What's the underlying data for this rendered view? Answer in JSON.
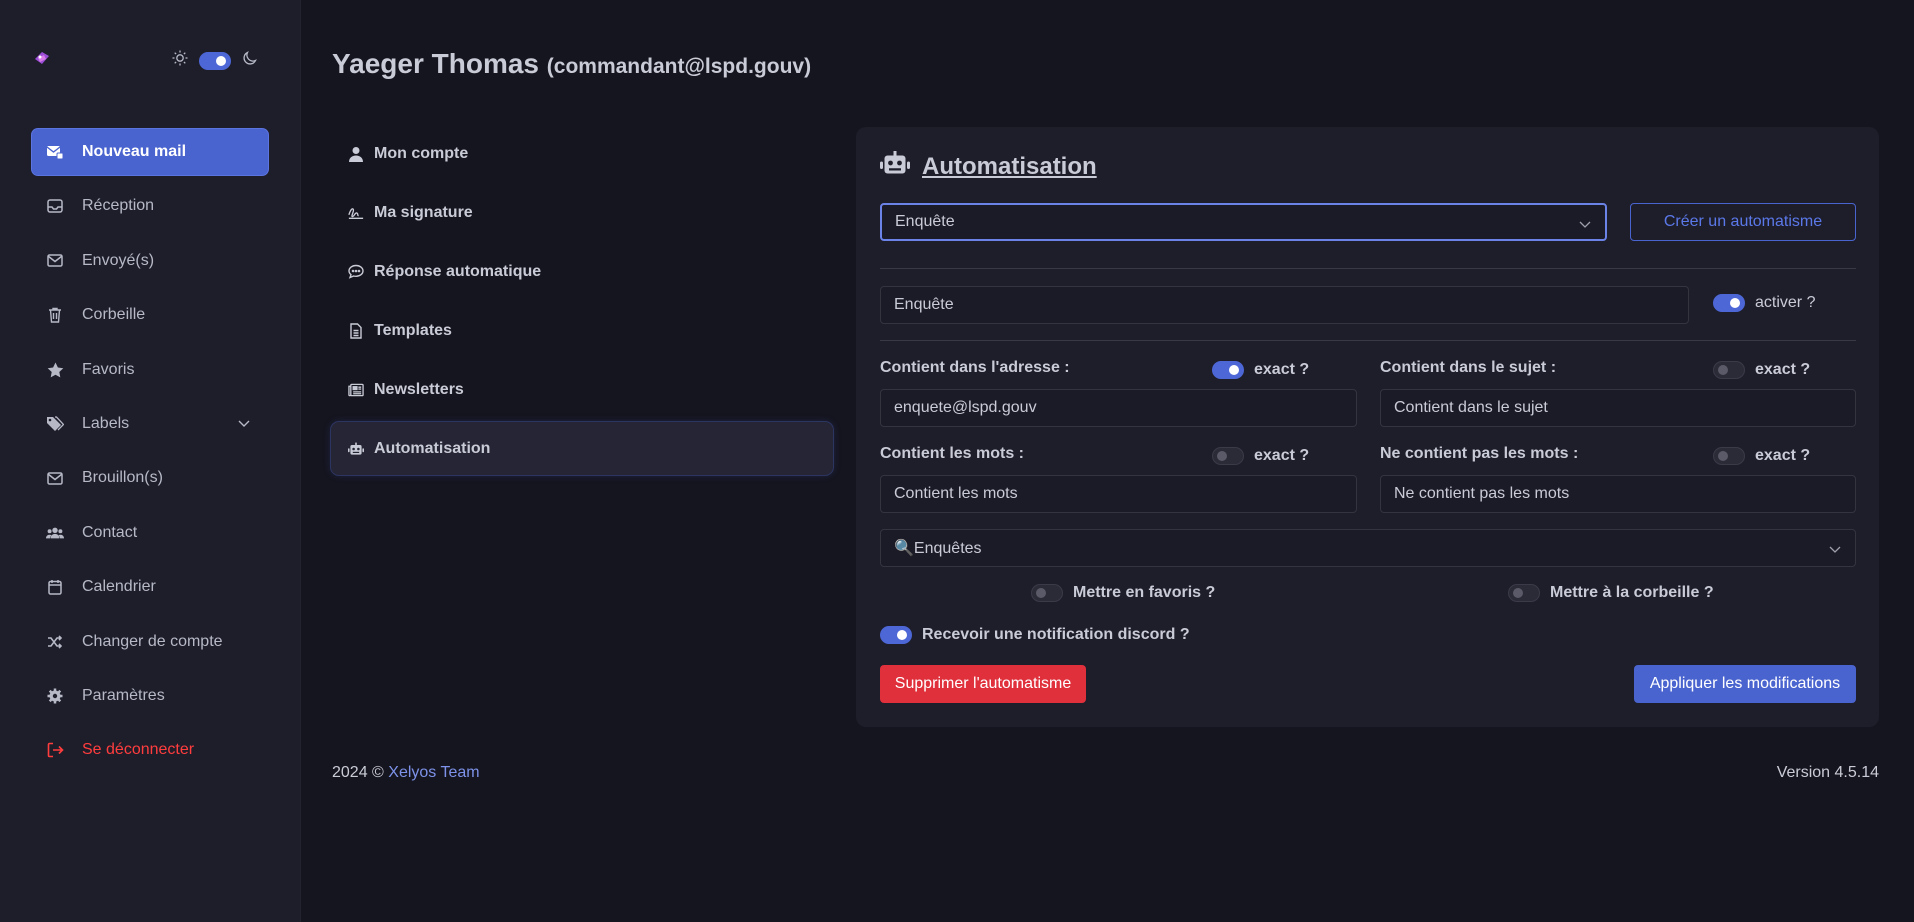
{
  "user": {
    "name": "Yaeger Thomas",
    "email": "(commandant@lspd.gouv)"
  },
  "sidebar": {
    "items": [
      {
        "label": "Nouveau mail",
        "icon": "new-mail-icon"
      },
      {
        "label": "Réception",
        "icon": "inbox-icon"
      },
      {
        "label": "Envoyé(s)",
        "icon": "sent-icon"
      },
      {
        "label": "Corbeille",
        "icon": "trash-icon"
      },
      {
        "label": "Favoris",
        "icon": "star-icon"
      },
      {
        "label": "Labels",
        "icon": "tags-icon"
      },
      {
        "label": "Brouillon(s)",
        "icon": "draft-icon"
      },
      {
        "label": "Contact",
        "icon": "users-icon"
      },
      {
        "label": "Calendrier",
        "icon": "calendar-icon"
      },
      {
        "label": "Changer de compte",
        "icon": "shuffle-icon"
      },
      {
        "label": "Paramètres",
        "icon": "gear-icon"
      },
      {
        "label": "Se déconnecter",
        "icon": "logout-icon"
      }
    ]
  },
  "settings_menu": {
    "items": [
      {
        "label": "Mon compte",
        "icon": "user-icon"
      },
      {
        "label": "Ma signature",
        "icon": "signature-icon"
      },
      {
        "label": "Réponse automatique",
        "icon": "comment-icon"
      },
      {
        "label": "Templates",
        "icon": "file-icon"
      },
      {
        "label": "Newsletters",
        "icon": "newspaper-icon"
      },
      {
        "label": "Automatisation",
        "icon": "robot-icon"
      }
    ]
  },
  "automation": {
    "title": "Automatisation",
    "selected": "Enquête",
    "create_label": "Créer un automatisme",
    "name_value": "Enquête",
    "activate_label": "activer ?",
    "address_label": "Contient dans l'adresse :",
    "address_value": "enquete@lspd.gouv",
    "subject_label": "Contient dans le sujet :",
    "subject_placeholder": "Contient dans le sujet",
    "words_label": "Contient les mots :",
    "words_placeholder": "Contient les mots",
    "notwords_label": "Ne contient pas les mots :",
    "notwords_placeholder": "Ne contient pas les mots",
    "exact_label": "exact ?",
    "folder_value": "🔍Enquêtes",
    "favorite_label": "Mettre en favoris ?",
    "trash_label": "Mettre à la corbeille ?",
    "discord_label": "Recevoir une notification discord ?",
    "delete_label": "Supprimer l'automatisme",
    "apply_label": "Appliquer les modifications"
  },
  "footer": {
    "year": "2024 ©",
    "team": "Xelyos Team",
    "version": "Version 4.5.14"
  },
  "colors": {
    "accent": "#4a64cf",
    "danger": "#e0303c",
    "background": "#15151f",
    "panel": "#1e1e2b"
  }
}
